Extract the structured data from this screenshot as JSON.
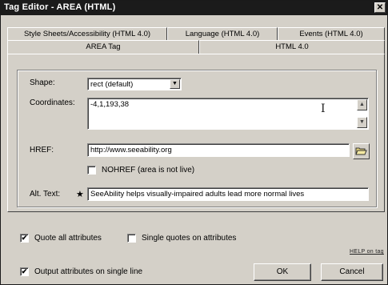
{
  "window": {
    "title": "Tag Editor - AREA   (HTML)",
    "close_glyph": "✕"
  },
  "tabs": {
    "row1": [
      "Style Sheets/Accessibility (HTML 4.0)",
      "Language (HTML 4.0)",
      "Events (HTML 4.0)"
    ],
    "row2": [
      "AREA Tag",
      "HTML 4.0"
    ],
    "active": "AREA Tag"
  },
  "form": {
    "shape_label": "Shape:",
    "shape_value": "rect (default)",
    "coordinates_label": "Coordinates:",
    "coordinates_value": "-4,1,193,38",
    "href_label": "HREF:",
    "href_value": "http://www.seeability.org",
    "nohref_label": "NOHREF (area is not live)",
    "nohref_checked": false,
    "alt_label": "Alt. Text:",
    "alt_required_marker": "★",
    "alt_value": "SeeAbility helps visually-impaired adults lead more normal lives"
  },
  "options": {
    "quote_all_label": "Quote all attributes",
    "quote_all_checked": true,
    "single_quotes_label": "Single quotes on attributes",
    "single_quotes_checked": false,
    "single_line_label": "Output attributes on single line",
    "single_line_checked": true
  },
  "buttons": {
    "help": "HELP on tag",
    "ok": "OK",
    "cancel": "Cancel"
  },
  "icons": {
    "dropdown": "chevron-down-icon",
    "scroll_up": "arrow-up-icon",
    "scroll_down": "arrow-down-icon",
    "browse": "folder-open-icon",
    "cursor": "text-cursor-icon",
    "check": "✔"
  }
}
